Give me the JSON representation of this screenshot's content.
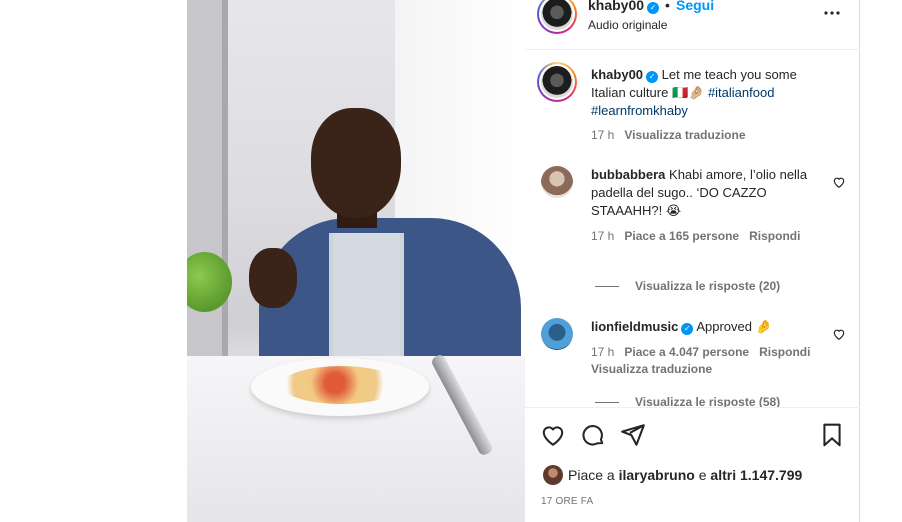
{
  "post": {
    "username": "khaby00",
    "dot": "•",
    "follow_label": "Segui",
    "audio": "Audio originale",
    "more_icon": "more-horizontal-icon"
  },
  "caption": {
    "username": "khaby00",
    "text": "Let me teach you some Italian culture ",
    "emoji": "🇮🇹🤌🏼",
    "hashtags": [
      "#italianfood",
      "#learnfromkhaby"
    ],
    "time": "17 h",
    "translate": "Visualizza traduzione"
  },
  "comments": [
    {
      "username": "bubbabbera",
      "text": "Khabi amore, l’olio nella padella del sugo.. ‘DO CAZZO STAAAHH?! ",
      "emoji": "😭",
      "time": "17 h",
      "likes": "Piace a 165 persone",
      "reply": "Rispondi",
      "view_replies": "Visualizza le risposte (20)"
    },
    {
      "username": "lionfieldmusic",
      "text": "Approved ",
      "emoji": "🤌",
      "time": "17 h",
      "likes": "Piace a 4.047 persone",
      "reply": "Rispondi",
      "translate": "Visualizza traduzione",
      "view_replies": "Visualizza le risposte (58)"
    }
  ],
  "footer": {
    "likes_prefix": "Piace a ",
    "likes_user": "ilaryabruno",
    "likes_mid": " e ",
    "likes_others": "altri 1.147.799",
    "time_ago": "17 ORE FA"
  },
  "colors": {
    "accent": "#0095f6",
    "hashtag": "#00376b",
    "muted": "#737373",
    "text": "#262626"
  }
}
